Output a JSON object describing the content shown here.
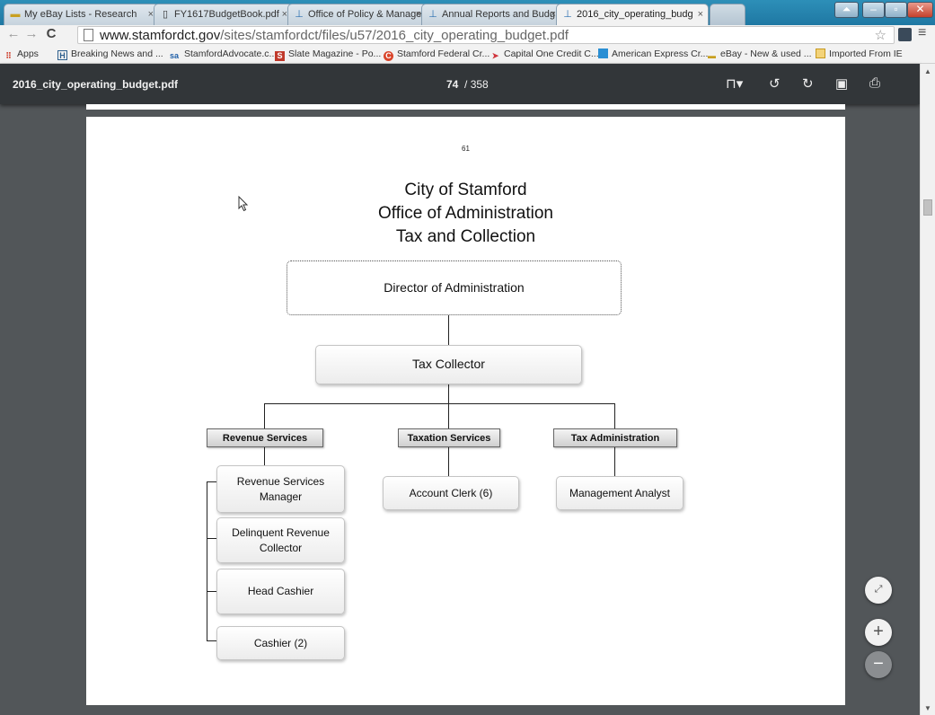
{
  "browser": {
    "tabs": [
      {
        "title": "My eBay Lists - Research",
        "icon": "ebay-icon"
      },
      {
        "title": "FY1617BudgetBook.pdf",
        "icon": "page-icon"
      },
      {
        "title": "Office of Policy & Manage",
        "icon": "site-icon"
      },
      {
        "title": "Annual Reports and Budg",
        "icon": "site-icon"
      },
      {
        "title": "2016_city_operating_budg",
        "icon": "site-icon",
        "active": true
      }
    ],
    "close_glyph": "×",
    "url_host": "www.stamfordct.gov",
    "url_path": "/sites/stamfordct/files/u57/2016_city_operating_budget.pdf",
    "bookmarks": [
      {
        "label": "Apps",
        "icon": "apps-grid-icon",
        "color": "#d04a3a"
      },
      {
        "label": "Breaking News and ...",
        "icon": "h-icon",
        "color": "#2c5e8c"
      },
      {
        "label": "StamfordAdvocate.c...",
        "icon": "sa-icon",
        "color": "#1f5fa8"
      },
      {
        "label": "Slate Magazine - Po...",
        "icon": "slate-icon",
        "color": "#c0392b"
      },
      {
        "label": "Stamford Federal Cr...",
        "icon": "sfcu-icon",
        "color": "#d9452b"
      },
      {
        "label": "Capital One Credit C...",
        "icon": "capital-one-icon",
        "color": "#d0343c"
      },
      {
        "label": "American Express Cr...",
        "icon": "amex-icon",
        "color": "#2a8fd4"
      },
      {
        "label": "eBay - New & used ...",
        "icon": "ebay-icon",
        "color": "#c8a020"
      },
      {
        "label": "Imported From IE",
        "icon": "folder-icon",
        "color": "#e1b53a"
      }
    ]
  },
  "pdf": {
    "filename": "2016_city_operating_budget.pdf",
    "current_page": "74",
    "total_pages": "/ 358"
  },
  "document": {
    "page_number": "61",
    "title_lines": [
      "City of Stamford",
      "Office of Administration",
      "Tax and Collection"
    ],
    "org": {
      "director": "Director of Administration",
      "collector": "Tax Collector",
      "divisions": [
        {
          "name": "Revenue Services",
          "roles": [
            "Revenue Services Manager",
            "Delinquent Revenue Collector",
            "Head Cashier",
            "Cashier (2)"
          ]
        },
        {
          "name": "Taxation Services",
          "roles": [
            "Account Clerk (6)"
          ]
        },
        {
          "name": "Tax Administration",
          "roles": [
            "Management Analyst"
          ]
        }
      ]
    }
  },
  "zoom": {
    "fit_label": "⤢",
    "in_label": "+",
    "out_label": "−"
  }
}
